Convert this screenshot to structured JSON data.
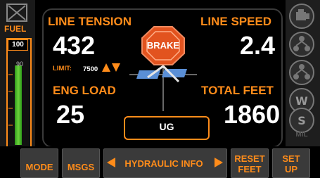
{
  "fuel": {
    "label": "FUEL",
    "max_label": "100",
    "mark_label": "90",
    "level_fraction": 0.75
  },
  "line_tension": {
    "label": "LINE TENSION",
    "value": "432",
    "limit_label": "LIMIT:",
    "limit_value": "7500"
  },
  "line_speed": {
    "label": "LINE SPEED",
    "value": "2.4"
  },
  "eng_load": {
    "label": "ENG LOAD",
    "value": "25"
  },
  "total_feet": {
    "label": "TOTAL FEET",
    "value": "1860"
  },
  "brake": {
    "label": "BRAKE"
  },
  "mode_display": {
    "value": "UG"
  },
  "right_icons": {
    "mil_label": "MIL",
    "icons": [
      "engine-icon",
      "network-icon",
      "network-icon",
      "warning-icon",
      "service-icon"
    ]
  },
  "bottom_bar": {
    "mode": "MODE",
    "msgs": "MSGS",
    "hydraulic_info": "HYDRAULIC INFO",
    "reset_feet_line1": "RESET",
    "reset_feet_line2": "FEET",
    "setup_line1": "SET",
    "setup_line2": "UP"
  },
  "colors": {
    "accent": "#ff8c1a",
    "value": "#ffffff",
    "brake_red": "#e2531f",
    "fuel_green": "#5fc83a",
    "logo_blue": "#5a8fd6"
  }
}
